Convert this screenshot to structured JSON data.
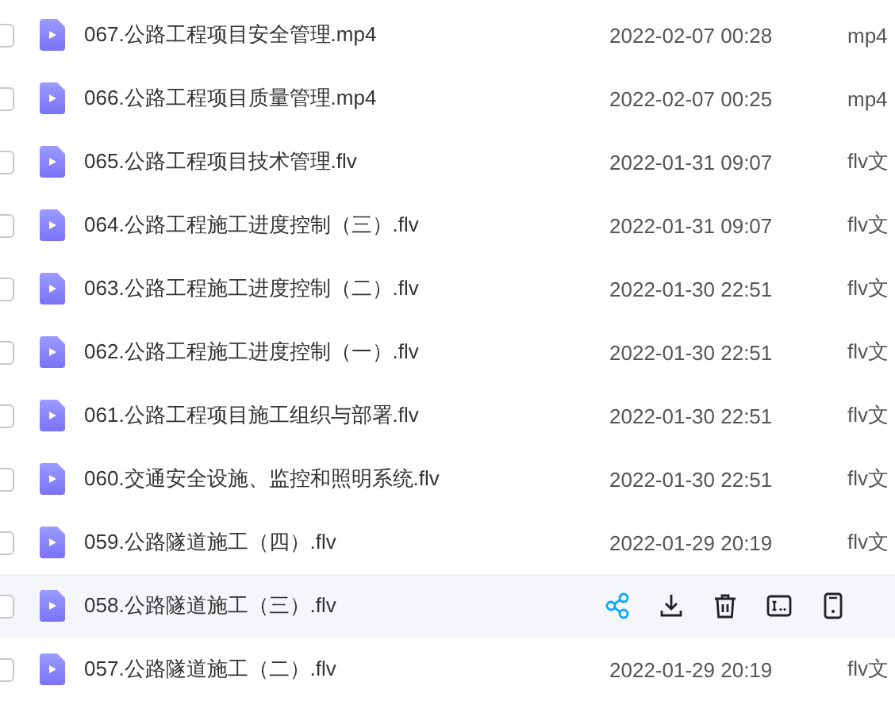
{
  "files": [
    {
      "name": "067.公路工程项目安全管理.mp4",
      "date": "2022-02-07 00:28",
      "type": "mp4",
      "checked": false,
      "hovered": false
    },
    {
      "name": "066.公路工程项目质量管理.mp4",
      "date": "2022-02-07 00:25",
      "type": "mp4",
      "checked": false,
      "hovered": false
    },
    {
      "name": "065.公路工程项目技术管理.flv",
      "date": "2022-01-31 09:07",
      "type": "flv文",
      "checked": false,
      "hovered": false
    },
    {
      "name": "064.公路工程施工进度控制（三）.flv",
      "date": "2022-01-31 09:07",
      "type": "flv文",
      "checked": false,
      "hovered": false
    },
    {
      "name": "063.公路工程施工进度控制（二）.flv",
      "date": "2022-01-30 22:51",
      "type": "flv文",
      "checked": false,
      "hovered": false
    },
    {
      "name": "062.公路工程施工进度控制（一）.flv",
      "date": "2022-01-30 22:51",
      "type": "flv文",
      "checked": false,
      "hovered": false
    },
    {
      "name": "061.公路工程项目施工组织与部署.flv",
      "date": "2022-01-30 22:51",
      "type": "flv文",
      "checked": false,
      "hovered": false
    },
    {
      "name": "060.交通安全设施、监控和照明系统.flv",
      "date": "2022-01-30 22:51",
      "type": "flv文",
      "checked": false,
      "hovered": false
    },
    {
      "name": "059.公路隧道施工（四）.flv",
      "date": "2022-01-29 20:19",
      "type": "flv文",
      "checked": false,
      "hovered": false
    },
    {
      "name": "058.公路隧道施工（三）.flv",
      "checked": false,
      "hovered": true,
      "actions": [
        {
          "kind": "share"
        },
        {
          "kind": "download"
        },
        {
          "kind": "delete"
        },
        {
          "kind": "rename"
        },
        {
          "kind": "phone"
        }
      ]
    },
    {
      "name": "057.公路隧道施工（二）.flv",
      "date": "2022-01-29 20:19",
      "type": "flv文",
      "checked": false,
      "hovered": false
    }
  ]
}
